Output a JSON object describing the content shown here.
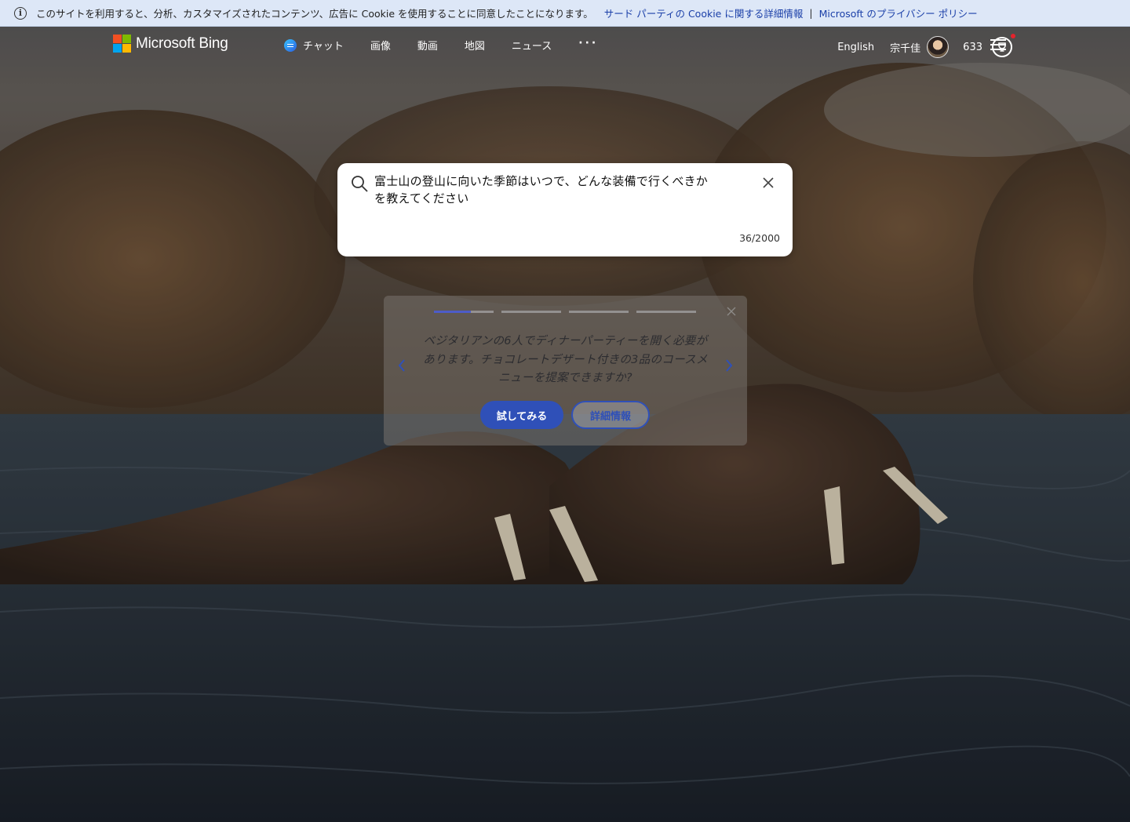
{
  "cookie_bar": {
    "message": "このサイトを利用すると、分析、カスタマイズされたコンテンツ、広告に Cookie を使用することに同意したことになります。",
    "link_cookie": "サード パーティの Cookie に関する詳細情報",
    "separator": "|",
    "link_privacy": "Microsoft のプライバシー ポリシー"
  },
  "header": {
    "logo_text": "Microsoft Bing",
    "logo_colors": [
      "#f25022",
      "#7fba00",
      "#00a4ef",
      "#ffb900"
    ],
    "nav": {
      "chat": "チャット",
      "images": "画像",
      "videos": "動画",
      "maps": "地図",
      "news": "ニュース",
      "more": "···"
    },
    "language": "English",
    "user_name": "宗千佳",
    "points": "633"
  },
  "search": {
    "query": "富士山の登山に向いた季節はいつで、どんな装備で行くべきかを教えてください",
    "char_count": "36/2000"
  },
  "suggestion_card": {
    "text": "ベジタリアンの6人でディナーパーティーを開く必要があります。チョコレートデザート付きの3品のコースメニューを提案できますか?",
    "try_button": "試してみる",
    "more_button": "詳細情報",
    "progress_steps": 4,
    "active_step": 1
  },
  "colors": {
    "accent": "#2f50b8",
    "cookie_bar_bg": "#dde7f7",
    "link": "#1a3fa8"
  }
}
